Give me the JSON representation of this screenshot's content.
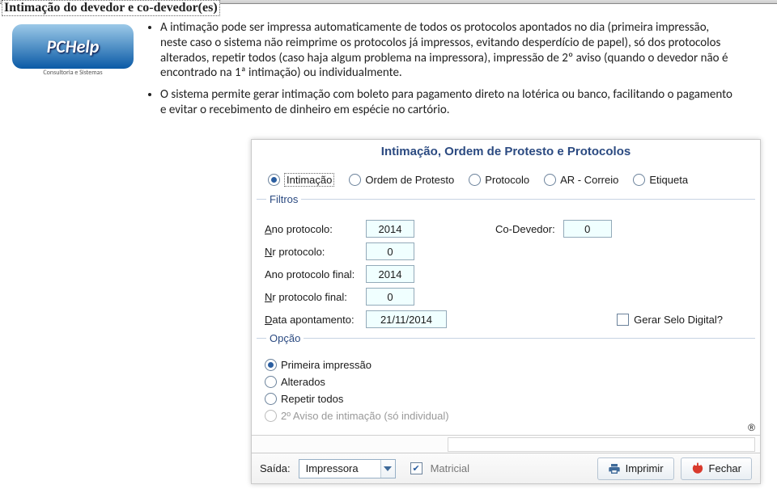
{
  "page": {
    "title": "Intimação do devedor e co-devedor(es)",
    "logo_text": "PCHelp",
    "logo_sub": "Consultoria e Sistemas",
    "bullets": [
      "A intimação pode ser impressa automaticamente de todos os protocolos apontados no dia (primeira impressão, neste caso o sistema não reimprime os protocolos já impressos, evitando desperdício de papel), só dos protocolos alterados, repetir todos (caso haja algum problema na impressora), impressão de 2º aviso (quando o devedor não é encontrado na 1ª intimação) ou individualmente.",
      "O sistema permite gerar intimação com boleto para pagamento direto na lotérica ou banco, facilitando o pagamento e evitar o recebimento de dinheiro em espécie no cartório."
    ]
  },
  "window": {
    "title": "Intimação, Ordem de Protesto e Protocolos",
    "tabs": {
      "intimacao": "Intimação",
      "ordem": "Ordem de Protesto",
      "protocolo": "Protocolo",
      "ar": "AR - Correio",
      "etiqueta": "Etiqueta"
    },
    "filters": {
      "group": "Filtros",
      "ano_label_pre": "A",
      "ano_label_post": "no protocolo:",
      "ano_value": "2014",
      "co_label": "Co-Devedor:",
      "co_value": "0",
      "nr_label_pre": "N",
      "nr_label_post": "r protocolo:",
      "nr_value": "0",
      "ano_fin_label": "Ano protocolo final:",
      "ano_fin_value": "2014",
      "nr_fin_label_pre": "N",
      "nr_fin_label_post": "r protocolo final:",
      "nr_fin_value": "0",
      "data_label_pre": "D",
      "data_label_post": "ata apontamento:",
      "data_value": "21/11/2014",
      "selo_label": "Gerar Selo Digital?"
    },
    "options": {
      "group": "Opção",
      "primeira": "Primeira impressão",
      "alterados": "Alterados",
      "repetir": "Repetir todos",
      "segundo": "2º Aviso de intimação (só individual)"
    },
    "footer": {
      "saida_label": "Saída:",
      "saida_value": "Impressora",
      "matricial": "Matricial",
      "imprimir": "Imprimir",
      "fechar": "Fechar"
    },
    "registered": "®"
  }
}
